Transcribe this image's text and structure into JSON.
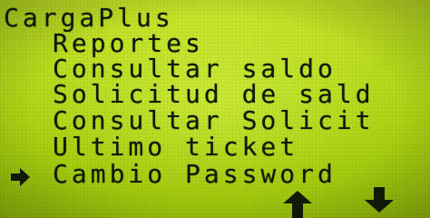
{
  "screen": {
    "title": "CargaPlus",
    "menu_items": [
      {
        "label": "Reportes"
      },
      {
        "label": "Consultar saldo"
      },
      {
        "label": "Solicitud de sald"
      },
      {
        "label": "Consultar Solicit"
      },
      {
        "label": "Ultimo ticket"
      },
      {
        "label": "Cambio Password"
      }
    ],
    "selected_index": 5
  },
  "icons": {
    "cursor": "right-arrow-icon",
    "scroll_up": "up-arrow-icon",
    "scroll_down": "down-arrow-icon"
  },
  "colors": {
    "lcd_background": "#b7da1c",
    "lcd_text": "#101a06"
  }
}
